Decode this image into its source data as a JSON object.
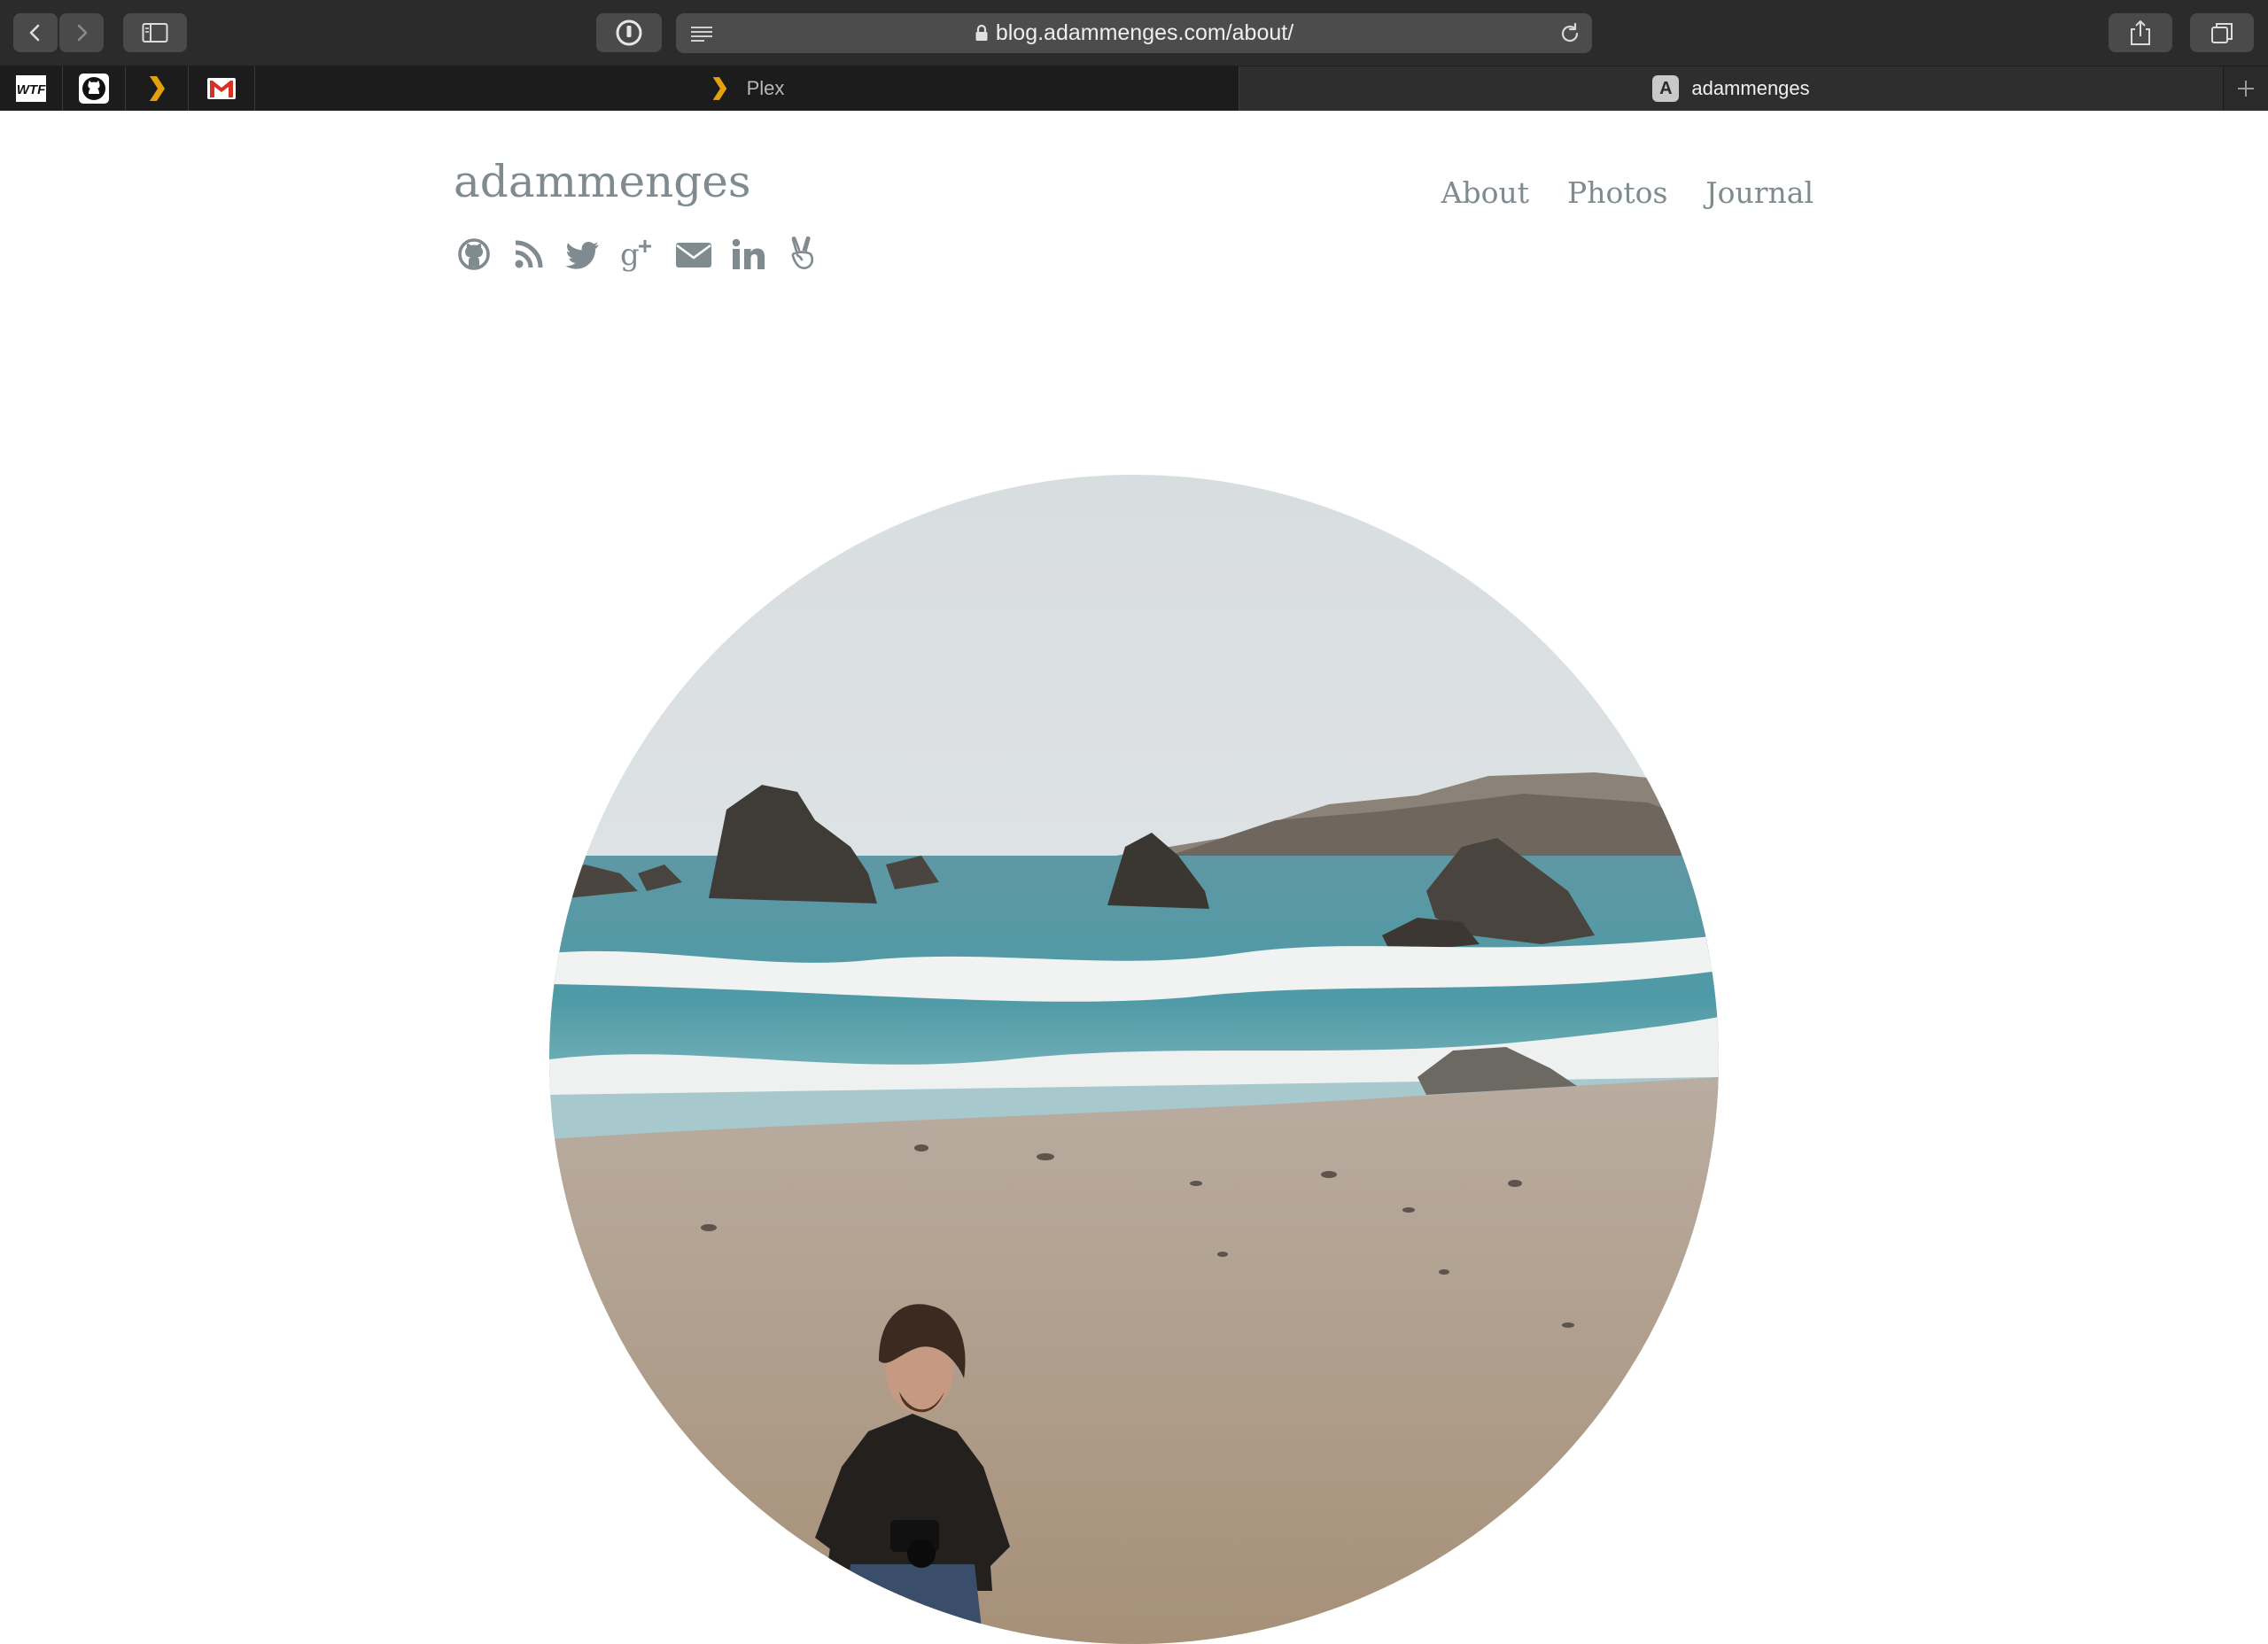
{
  "browser": {
    "url": "blog.adammenges.com/about/",
    "pinned_tabs": [
      {
        "name": "WTF"
      },
      {
        "name": "GitHub"
      },
      {
        "name": "Plex"
      },
      {
        "name": "Gmail"
      }
    ],
    "tabs": [
      {
        "title": "Plex",
        "active": false
      },
      {
        "title": "adammenges",
        "active": true,
        "favicon_letter": "A"
      }
    ]
  },
  "site": {
    "title": "adammenges",
    "nav": [
      {
        "label": "About"
      },
      {
        "label": "Photos"
      },
      {
        "label": "Journal"
      }
    ],
    "social_icons": [
      "github-icon",
      "rss-icon",
      "twitter-icon",
      "google-plus-icon",
      "envelope-icon",
      "linkedin-icon",
      "angellist-icon"
    ]
  },
  "colors": {
    "text_accent": "#7f8b8f",
    "toolbar_bg": "#2b2b2b",
    "tab_active_bg": "#2e2e2e",
    "plex_orange": "#e5a00d",
    "gmail_red": "#d93025"
  }
}
